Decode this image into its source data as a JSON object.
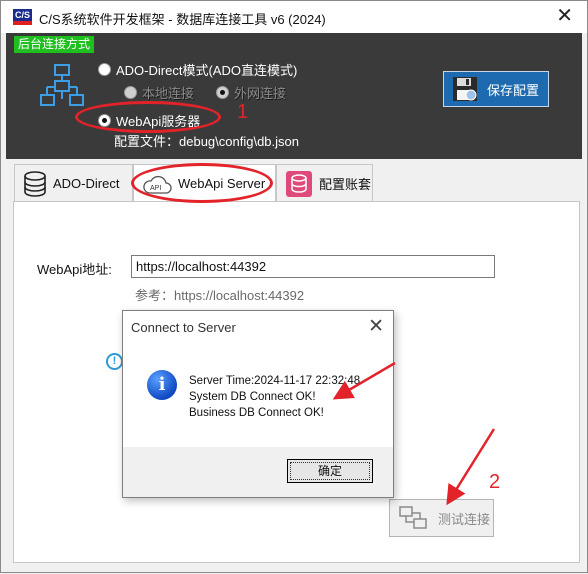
{
  "window": {
    "app_icon_text": "C/S",
    "title": "C/S系统软件开发框架 - 数据库连接工具 v6 (2024)",
    "close_glyph": "✕"
  },
  "header": {
    "mode_label": "后台连接方式",
    "radio_ado": "ADO-Direct模式(ADO直连模式)",
    "radio_local": "本地连接",
    "radio_wan": "外网连接",
    "radio_webapi": "WebApi服务器",
    "config_file": "配置文件：debug\\config\\db.json",
    "save_button": "保存配置",
    "network_icon": "network-icon",
    "floppy_icon": "floppy-disk-icon"
  },
  "tabs": [
    {
      "label": "ADO-Direct",
      "icon": "database-icon"
    },
    {
      "label": "WebApi Server",
      "icon": "cloud-api-icon"
    },
    {
      "label": "配置账套",
      "icon": "database-pink-icon"
    }
  ],
  "webapi": {
    "field_label": "WebApi地址:",
    "url_value": "https://localhost:44392",
    "hint": "参考：https://localhost:44392",
    "test_button": "测试连接",
    "info_glyph": "!"
  },
  "dialog": {
    "title": "Connect to Server",
    "close_glyph": "✕",
    "info_glyph": "i",
    "lines": [
      "Server Time:2024-11-17 22:32:48",
      "System DB Connect OK!",
      "Business DB Connect OK!"
    ],
    "ok_button": "确定"
  },
  "annotations": {
    "label_1": "1",
    "label_2": "2",
    "color": "#e3232a"
  },
  "colors": {
    "header_bg": "#3a3a3a",
    "mode_label_bg": "#1fbf1f",
    "save_button_bg": "#1e6ab0"
  }
}
